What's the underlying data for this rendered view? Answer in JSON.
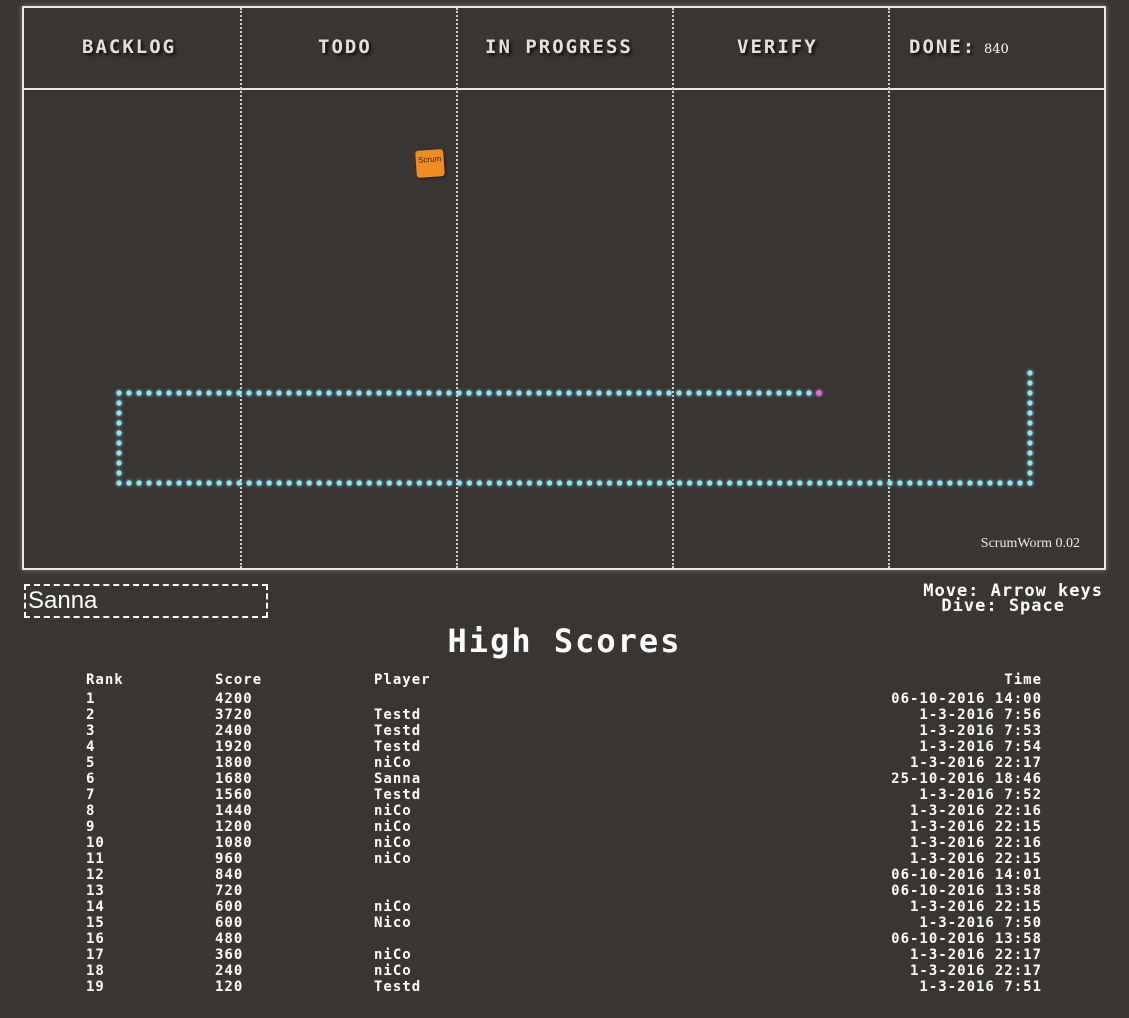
{
  "board": {
    "columns": [
      "BACKLOG",
      "TODO",
      "IN PROGRESS",
      "VERIFY",
      "DONE:"
    ],
    "done_score": "840",
    "sticky_label": "Scrum",
    "version": "ScrumWorm 0.02",
    "colors": {
      "background": "#383532",
      "border": "#e8e8e8",
      "worm": "#8fe6f2",
      "worm_head": "#e06ad8",
      "sticky": "#f08a24"
    }
  },
  "player_input": {
    "value": "Sanna"
  },
  "help": {
    "move": "Move: Arrow keys",
    "dive": "Dive: Space"
  },
  "high_scores": {
    "title": "High Scores",
    "headers": {
      "rank": "Rank",
      "score": "Score",
      "player": "Player",
      "time": "Time"
    },
    "rows": [
      {
        "rank": "1",
        "score": "4200",
        "player": "",
        "time": "06-10-2016 14:00"
      },
      {
        "rank": "2",
        "score": "3720",
        "player": "Testd",
        "time": "1-3-2016 7:56"
      },
      {
        "rank": "3",
        "score": "2400",
        "player": "Testd",
        "time": "1-3-2016 7:53"
      },
      {
        "rank": "4",
        "score": "1920",
        "player": "Testd",
        "time": "1-3-2016 7:54"
      },
      {
        "rank": "5",
        "score": "1800",
        "player": "niCo",
        "time": "1-3-2016 22:17"
      },
      {
        "rank": "6",
        "score": "1680",
        "player": "Sanna",
        "time": "25-10-2016 18:46"
      },
      {
        "rank": "7",
        "score": "1560",
        "player": "Testd",
        "time": "1-3-2016 7:52"
      },
      {
        "rank": "8",
        "score": "1440",
        "player": "niCo",
        "time": "1-3-2016 22:16"
      },
      {
        "rank": "9",
        "score": "1200",
        "player": "niCo",
        "time": "1-3-2016 22:15"
      },
      {
        "rank": "10",
        "score": "1080",
        "player": "niCo",
        "time": "1-3-2016 22:16"
      },
      {
        "rank": "11",
        "score": "960",
        "player": "niCo",
        "time": "1-3-2016 22:15"
      },
      {
        "rank": "12",
        "score": "840",
        "player": "",
        "time": "06-10-2016 14:01"
      },
      {
        "rank": "13",
        "score": "720",
        "player": "",
        "time": "06-10-2016 13:58"
      },
      {
        "rank": "14",
        "score": "600",
        "player": "niCo",
        "time": "1-3-2016 22:15"
      },
      {
        "rank": "15",
        "score": "600",
        "player": "Nico",
        "time": "1-3-2016 7:50"
      },
      {
        "rank": "16",
        "score": "480",
        "player": "",
        "time": "06-10-2016 13:58"
      },
      {
        "rank": "17",
        "score": "360",
        "player": "niCo",
        "time": "1-3-2016 22:17"
      },
      {
        "rank": "18",
        "score": "240",
        "player": "niCo",
        "time": "1-3-2016 22:17"
      },
      {
        "rank": "19",
        "score": "120",
        "player": "Testd",
        "time": "1-3-2016 7:51"
      }
    ]
  }
}
